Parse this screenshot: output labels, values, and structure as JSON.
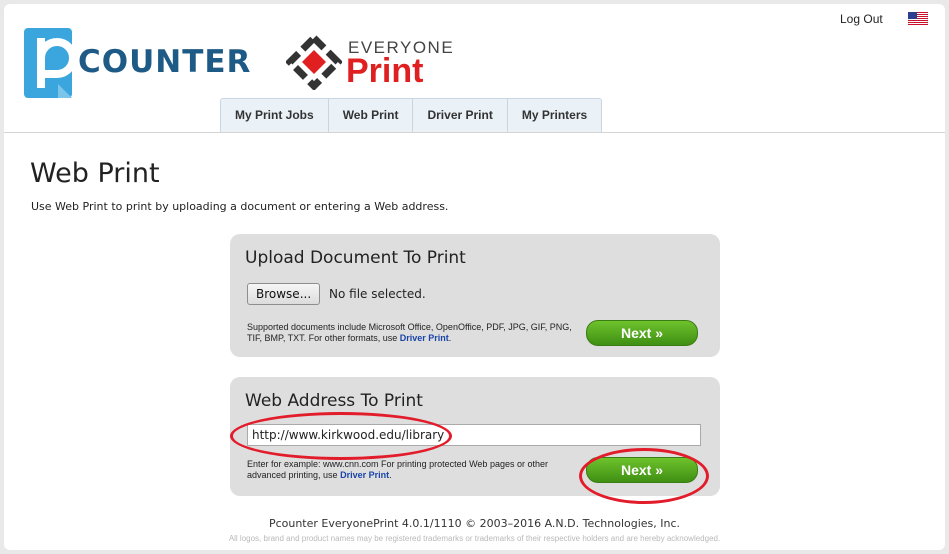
{
  "header": {
    "logo_pcounter_text": "COUNTER",
    "logo_everyone_line1": "EVERYONE",
    "logo_everyone_line2": "Print",
    "logout_label": "Log Out",
    "flag_icon": "us-flag-icon"
  },
  "tabs": [
    {
      "label": "My Print Jobs"
    },
    {
      "label": "Web Print"
    },
    {
      "label": "Driver Print"
    },
    {
      "label": "My Printers"
    }
  ],
  "page": {
    "title": "Web Print",
    "description": "Use Web Print to print by uploading a document or entering a Web address."
  },
  "upload": {
    "heading": "Upload Document To Print",
    "browse_label": "Browse...",
    "file_status": "No file selected.",
    "help_text": "Supported documents include Microsoft Office, OpenOffice, PDF, JPG, GIF, PNG, TIF, BMP, TXT. For other formats, use ",
    "help_link": "Driver Print",
    "help_end": ".",
    "next_label": "Next »"
  },
  "web": {
    "heading": "Web Address To Print",
    "url_value": "http://www.kirkwood.edu/library",
    "help_text": "Enter for example: www.cnn.com For printing protected Web pages or other advanced printing, use ",
    "help_link": "Driver Print",
    "help_end": ".",
    "next_label": "Next »"
  },
  "footer": {
    "version": "Pcounter EveryonePrint 4.0.1/1110 © 2003–2016 A.N.D. Technologies, Inc.",
    "note": "All logos, brand and product names may be registered trademarks or trademarks of their respective holders and are hereby acknowledged."
  },
  "colors": {
    "pcounter_blue": "#3aa6dd",
    "everyone_red": "#e02020",
    "next_green": "#4fa81c",
    "annotation_red": "#e21c2a"
  }
}
